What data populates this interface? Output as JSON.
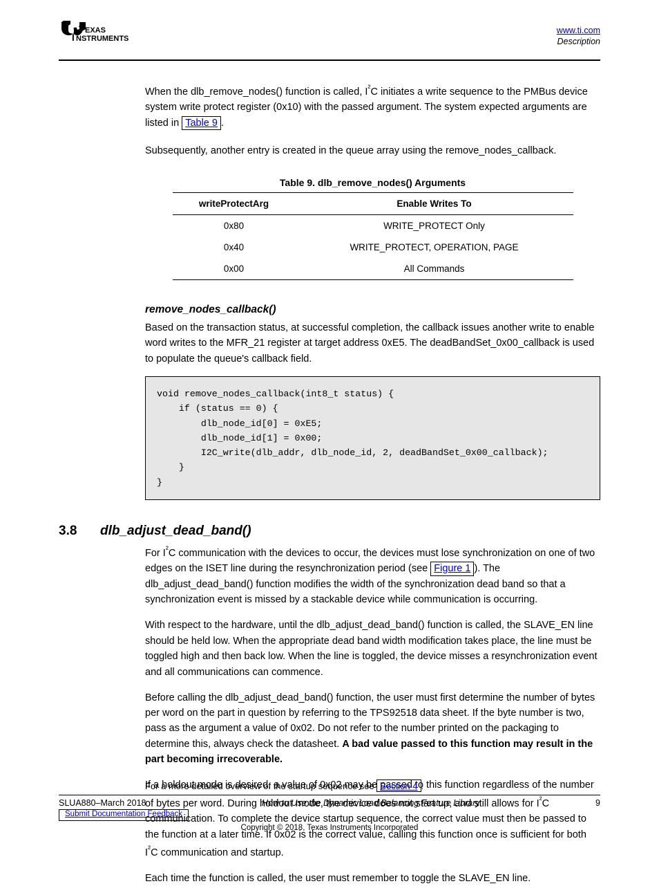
{
  "header": {
    "logo_alt": "Texas Instruments",
    "right_l1": "www.ti.com",
    "right_l2": "Description"
  },
  "intro": {
    "p1a": "When the dlb_remove_nodes() function is called, I",
    "p1b": "²",
    "p1c": "C initiates a write sequence to the PMBus device system write protect register (0x10) with the passed argument. The system expected arguments are listed in ",
    "p1_link": "Table 9",
    "p1d": ".",
    "p2": "Subsequently, another entry is created in the queue array using the remove_nodes_callback."
  },
  "table": {
    "caption": "Table 9. dlb_remove_nodes() Arguments",
    "headers": [
      "writeProtectArg",
      "Enable Writes To"
    ],
    "rows": [
      [
        "0x80",
        "WRITE_PROTECT Only"
      ],
      [
        "0x40",
        "WRITE_PROTECT, OPERATION, PAGE"
      ],
      [
        "0x00",
        "All Commands"
      ]
    ]
  },
  "remove": {
    "heading": "remove_nodes_callback()",
    "prose": "Based on the transaction status, at successful completion, the callback issues another write to enable word writes to the MFR_21 register at target address 0xE5. The deadBandSet_0x00_callback is used to populate the queue's callback field.",
    "code": "void remove_nodes_callback(int8_t status) {\n    if (status == 0) {\n        dlb_node_id[0] = 0xE5;\n        dlb_node_id[1] = 0x00;\n        I2C_write(dlb_addr, dlb_node_id, 2, deadBandSet_0x00_callback);\n    }\n}"
  },
  "sec38": {
    "num": "3.8",
    "title": "dlb_adjust_dead_band()",
    "p1a": "For I",
    "p1b": "²",
    "p1c": "C communication with the devices to occur, the devices must lose synchronization on one of two edges on the ISET line during the resynchronization period (see ",
    "p1_link": "Figure 1",
    "p1d": "). The dlb_adjust_dead_band() function modifies the width of the synchronization dead band so that a synchronization event is missed by a stackable device while communication is occurring.",
    "p2": "With respect to the hardware, until the dlb_adjust_dead_band() function is called, the SLAVE_EN line should be held low. When the appropriate dead band width modification takes place, the line must be toggled high and then back low. When the line is toggled, the device misses a resynchronization event and all communications can commence.",
    "p3a": "Before calling the dlb_adjust_dead_band() function, the user must first determine the number of bytes per word on the part in question by referring to the TPS92518 data sheet. If the byte number is two, pass as the argument a value of 0x02. Do not refer to the number printed on the packaging to determine this, always check the datasheet. ",
    "p3b_strong": "A bad value passed to this function may result in the part becoming irrecoverable.",
    "p4a": "If a holdout mode is desired, a value of 0x02 may be passed to this function regardless of the number of bytes per word. During holdout mode, the device does not start up, and still allows for I",
    "p4b": "²",
    "p4c": "C communication. To complete the device startup sequence, the correct value must then be passed to the function at a later time. If 0x02 is the correct value, calling this function once is sufficient for both I",
    "p4d": "²",
    "p4e": "C communication and startup.",
    "p5": "Each time the function is called, the user must remember to toggle the SLAVE_EN line."
  },
  "footer": {
    "top_a": "For a more detailed overview of the startup sequence see ",
    "top_link": "Section 4",
    "top_b": ".",
    "left": "SLUA880–March 2018",
    "mid": "How to Use the Dynamic Load Balancing Feature Library",
    "right": "9",
    "sub_a": "Submit Documentation Feedback",
    "copyright": "Copyright © 2018, Texas Instruments Incorporated"
  }
}
